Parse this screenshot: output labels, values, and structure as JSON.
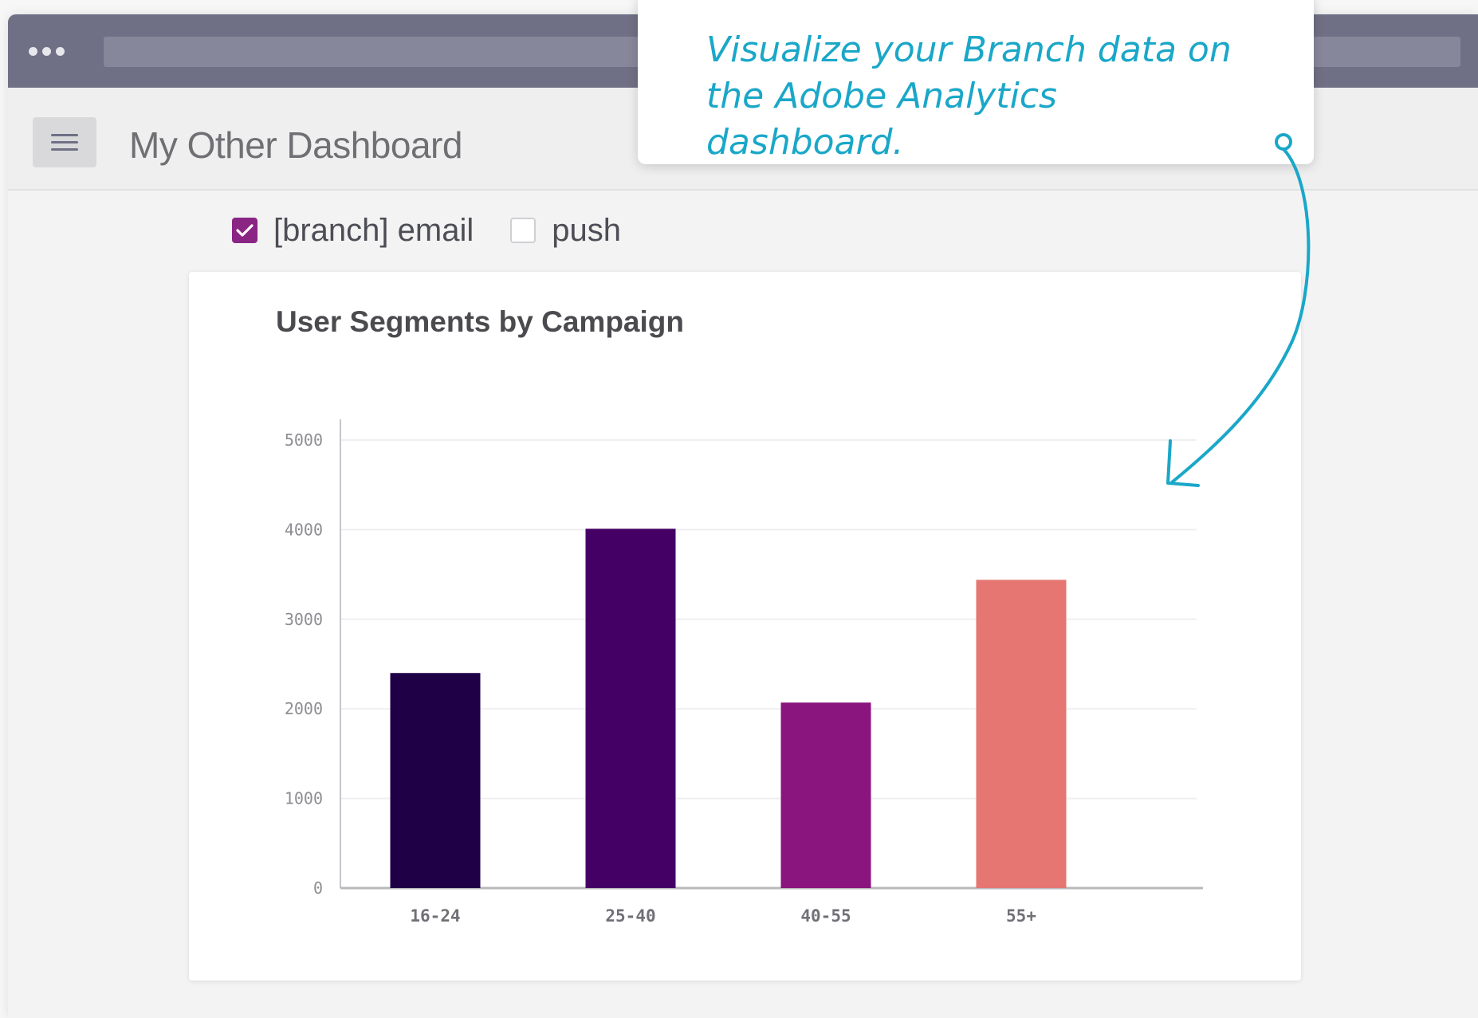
{
  "header": {
    "dashboard_title": "My Other Dashboard",
    "menu_icon": "hamburger-icon"
  },
  "filters": [
    {
      "label": "[branch] email",
      "checked": true
    },
    {
      "label": "push",
      "checked": false
    }
  ],
  "callout": {
    "text": "Visualize your Branch data on the Adobe Analytics dashboard."
  },
  "colors": {
    "accent": "#1aa7c8",
    "checkbox_checked": "#8a2584",
    "titlebar": "#6f7085",
    "bar_colors": [
      "#1f0046",
      "#450066",
      "#8a157e",
      "#e57672"
    ]
  },
  "chart_data": {
    "type": "bar",
    "title": "User Segments by Campaign",
    "categories": [
      "16-24",
      "25-40",
      "40-55",
      "55+"
    ],
    "values": [
      2400,
      4010,
      2070,
      3440
    ],
    "xlabel": "",
    "ylabel": "",
    "ylim": [
      0,
      5000
    ],
    "yticks": [
      0,
      1000,
      2000,
      3000,
      4000,
      5000
    ],
    "grid": true
  }
}
